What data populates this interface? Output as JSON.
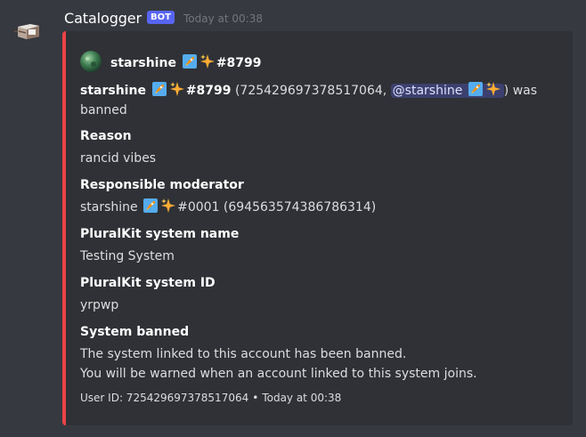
{
  "author": {
    "name": "Catalogger",
    "bot_tag": "BOT",
    "timestamp": "Today at 00:38"
  },
  "embed": {
    "accent_color": "#ed4245",
    "author_name": "starshine",
    "author_discriminator": "#8799",
    "author_emojis": [
      "rocket-icon",
      "sparkles-icon"
    ],
    "description": {
      "user_name": "starshine",
      "user_discriminator": "#8799",
      "open_text": " (725429697378517064, ",
      "mention": "@starshine",
      "close_text": ") was banned"
    },
    "fields": [
      {
        "name": "Reason",
        "value": "rancid vibes"
      },
      {
        "name": "Responsible moderator",
        "value_prefix": "starshine",
        "value_suffix": "#0001 (694563574386786314)"
      },
      {
        "name": "PluralKit system name",
        "value": "Testing System"
      },
      {
        "name": "PluralKit system ID",
        "value": "yrpwp"
      },
      {
        "name": "System banned",
        "value_line1": "The system linked to this account has been banned.",
        "value_line2": "You will be warned when an account linked to this system joins."
      }
    ],
    "footer": {
      "user_id": "User ID: 725429697378517064",
      "separator": "•",
      "timestamp": "Today at 00:38"
    }
  }
}
